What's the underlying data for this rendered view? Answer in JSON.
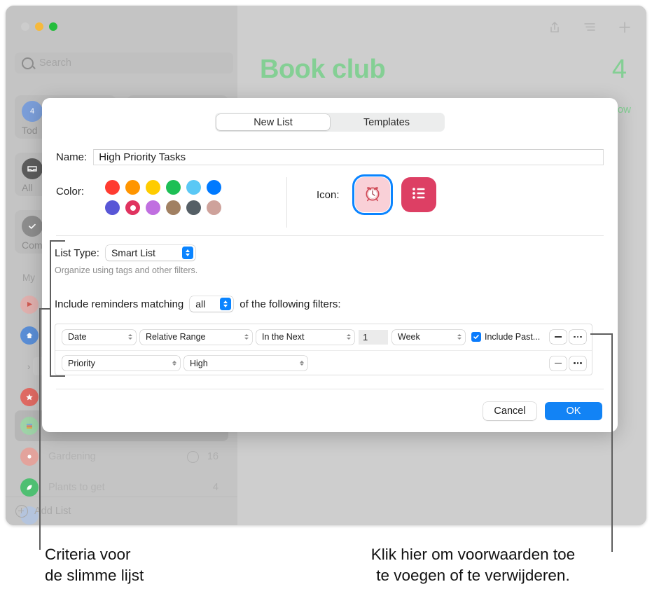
{
  "background_app": {
    "search_placeholder": "Search",
    "quick_cards": [
      {
        "label": "Tod",
        "badge": "4",
        "badge_color": "#7b9ed9"
      },
      {
        "label": "",
        "badge": "",
        "badge_color": "#d98a88"
      }
    ],
    "nav_items": [
      {
        "label": "All",
        "icon": "inbox-icon",
        "color": "#5c5c5c"
      },
      {
        "label": "Com",
        "icon": "check-circle-icon",
        "color": "#8d8d8d"
      }
    ],
    "section_title": "My",
    "lists": [
      {
        "label": "",
        "icon": "pin-icon",
        "count": "",
        "color": "#d99a9a"
      },
      {
        "label": "",
        "icon": "home-icon",
        "count": "",
        "color": "#5a8ed6"
      },
      {
        "label": "",
        "icon": "folder-icon",
        "count": "",
        "color": "#bdbdbd"
      },
      {
        "label": "",
        "icon": "star-icon",
        "count": "",
        "color": "#e06a63"
      },
      {
        "label": "",
        "icon": "books-icon",
        "count": "",
        "color": "#9fd3a8"
      },
      {
        "label": "Gardening",
        "icon": "flower-icon",
        "count": "16",
        "color": "#e3a39c",
        "shared": true
      },
      {
        "label": "Plants to get",
        "icon": "leaf-icon",
        "count": "4",
        "color": "#4fbf72"
      }
    ],
    "add_list_label": "Add List",
    "content_title": "Book club",
    "content_count": "4",
    "show_link": "how",
    "accent_green": "#84cf94",
    "toolbar_icons": [
      "share-icon",
      "list-view-icon",
      "plus-icon"
    ]
  },
  "dialog": {
    "tabs": [
      {
        "label": "New List",
        "active": true
      },
      {
        "label": "Templates",
        "active": false
      }
    ],
    "name": {
      "label": "Name:",
      "value": "High Priority Tasks"
    },
    "color": {
      "label": "Color:",
      "selected_index": 7,
      "swatches": [
        "#ff3b30",
        "#ff9500",
        "#ffcc00",
        "#1dbf55",
        "#5ac8f5",
        "#007aff",
        "#5856d6",
        "#e0335f",
        "#c06fe0",
        "#a18062",
        "#555f66",
        "#cea29b"
      ]
    },
    "icon": {
      "label": "Icon:",
      "options": [
        {
          "name": "alarm-clock-icon",
          "selected": true,
          "bg": "#f9d0d7"
        },
        {
          "name": "bulleted-list-icon",
          "selected": false,
          "bg": "#dd3f64"
        }
      ]
    },
    "list_type": {
      "label": "List Type:",
      "value": "Smart List",
      "helper": "Organize using tags and other filters."
    },
    "match": {
      "prefix": "Include reminders matching",
      "value": "all",
      "suffix": "of the following filters:"
    },
    "filters": [
      {
        "field": "Date",
        "comparator": "Relative Range",
        "relation": "In the Next",
        "amount": "1",
        "unit": "Week",
        "checkbox_label": "Include Past...",
        "checkbox_checked": true
      },
      {
        "field": "Priority",
        "comparator": "High"
      }
    ],
    "buttons": {
      "cancel": "Cancel",
      "ok": "OK",
      "remove_row": "remove-filter-button",
      "more_row": "more-options-button"
    },
    "accent_blue": "#0a84ff"
  },
  "annotations": [
    {
      "id": "left-callout",
      "text_line1": "Criteria voor",
      "text_line2": "de slimme lijst"
    },
    {
      "id": "right-callout",
      "text_line1": "Klik hier om voorwaarden toe",
      "text_line2": "te voegen of te verwijderen."
    }
  ]
}
